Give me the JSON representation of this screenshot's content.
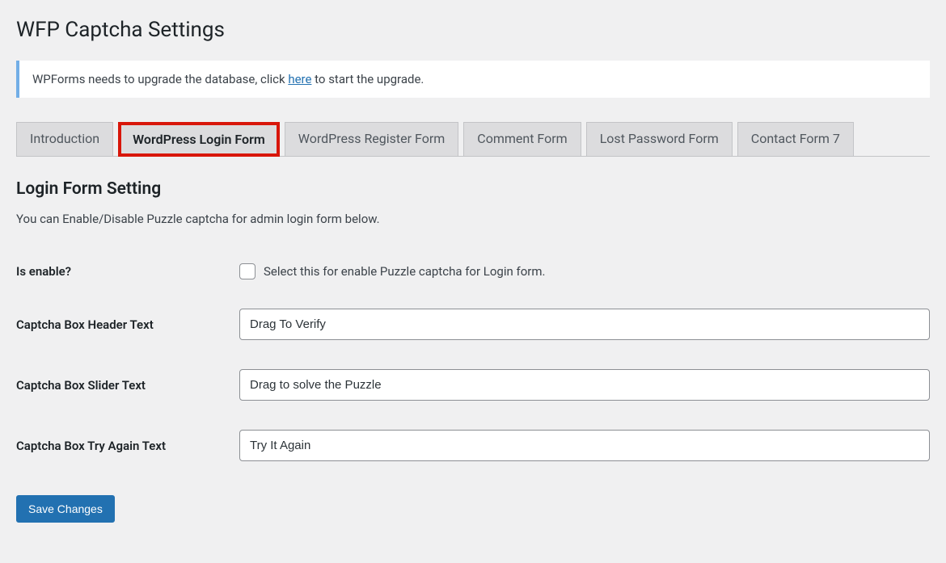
{
  "page": {
    "title": "WFP Captcha Settings"
  },
  "notice": {
    "prefix": "WPForms needs to upgrade the database, click ",
    "link_text": "here",
    "suffix": " to start the upgrade."
  },
  "tabs": [
    {
      "label": "Introduction",
      "highlighted": false
    },
    {
      "label": "WordPress Login Form",
      "highlighted": true
    },
    {
      "label": "WordPress Register Form",
      "highlighted": false
    },
    {
      "label": "Comment Form",
      "highlighted": false
    },
    {
      "label": "Lost Password Form",
      "highlighted": false
    },
    {
      "label": "Contact Form 7",
      "highlighted": false
    }
  ],
  "section": {
    "title": "Login Form Setting",
    "description": "You can Enable/Disable Puzzle captcha for admin login form below."
  },
  "fields": {
    "is_enable": {
      "label": "Is enable?",
      "checkbox_label": "Select this for enable Puzzle captcha for Login form.",
      "checked": false
    },
    "header_text": {
      "label": "Captcha Box Header Text",
      "value": "Drag To Verify"
    },
    "slider_text": {
      "label": "Captcha Box Slider Text",
      "value": "Drag to solve the Puzzle"
    },
    "try_again_text": {
      "label": "Captcha Box Try Again Text",
      "value": "Try It Again"
    }
  },
  "actions": {
    "save_label": "Save Changes"
  }
}
